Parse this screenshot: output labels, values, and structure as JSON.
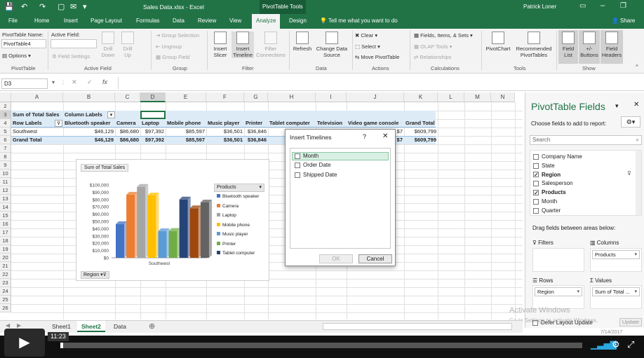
{
  "titlebar": {
    "doc": "Sales Data.xlsx - Excel",
    "tools": "PivotTable Tools",
    "user": "Patrick Loner"
  },
  "tabs": [
    "File",
    "Home",
    "Insert",
    "Page Layout",
    "Formulas",
    "Data",
    "Review",
    "View",
    "Analyze",
    "Design"
  ],
  "tellme": "Tell me what you want to do",
  "share": "Share",
  "ribbon": {
    "pt_name_label": "PivotTable Name:",
    "pt_name": "PivotTable4",
    "options": "Options",
    "group_pivottable": "PivotTable",
    "active_field_label": "Active Field:",
    "field_settings": "Field Settings",
    "drill_down": "Drill Down",
    "drill_up": "Drill Up",
    "group_active_field": "Active Field",
    "group_selection": "Group Selection",
    "ungroup": "Ungroup",
    "group_field": "Group Field",
    "group_group": "Group",
    "insert_slicer": "Insert Slicer",
    "insert_timeline": "Insert Timeline",
    "filter_connections": "Filter Connections",
    "group_filter": "Filter",
    "refresh": "Refresh",
    "change_data_source": "Change Data Source",
    "group_data": "Data",
    "clear": "Clear",
    "select": "Select",
    "move_pivottable": "Move PivotTable",
    "group_actions": "Actions",
    "fields_items_sets": "Fields, Items, & Sets",
    "olap_tools": "OLAP Tools",
    "relationships": "Relationships",
    "group_calculations": "Calculations",
    "pivotchart": "PivotChart",
    "recommended_pivottables": "Recommended PivotTables",
    "group_tools": "Tools",
    "field_list": "Field List",
    "buttons": "+/- Buttons",
    "field_headers": "Field Headers",
    "group_show": "Show"
  },
  "formula": {
    "namebox": "D3",
    "fx": "fx"
  },
  "columns": [
    {
      "l": "A",
      "w": 74
    },
    {
      "l": "B",
      "w": 74
    },
    {
      "l": "C",
      "w": 36
    },
    {
      "l": "D",
      "w": 36
    },
    {
      "l": "E",
      "w": 58
    },
    {
      "l": "F",
      "w": 54
    },
    {
      "l": "G",
      "w": 34
    },
    {
      "l": "H",
      "w": 68
    },
    {
      "l": "I",
      "w": 44
    },
    {
      "l": "J",
      "w": 82
    },
    {
      "l": "K",
      "w": 48
    },
    {
      "l": "L",
      "w": 38
    },
    {
      "l": "M",
      "w": 38
    },
    {
      "l": "N",
      "w": 34
    }
  ],
  "rows": [
    "2",
    "3",
    "4",
    "5",
    "6",
    "7",
    "8",
    "9",
    "10",
    "11",
    "12",
    "13",
    "14",
    "15",
    "16",
    "17",
    "18",
    "19",
    "20",
    "21",
    "22",
    "23",
    "24",
    "25",
    "26"
  ],
  "pivot": {
    "r3a": "Sum of Total Sales",
    "r3b": "Column Labels",
    "headers": [
      "Row Labels",
      "Bluetooth speaker",
      "Camera",
      "Laptop",
      "Mobile phone",
      "Music player",
      "Printer",
      "Tablet computer",
      "Television",
      "Video game console",
      "Grand Total"
    ],
    "r5": [
      "Southwest",
      "$46,129",
      "$86,680",
      "$97,392",
      "$85,597",
      "$36,501",
      "$36,846",
      "",
      "",
      "$7",
      "$609,799"
    ],
    "r6": [
      "Grand Total",
      "$46,129",
      "$86,680",
      "$97,392",
      "$85,597",
      "$36,501",
      "$36,846",
      "",
      "",
      "$7",
      "$609,799"
    ]
  },
  "chart_data": {
    "type": "bar",
    "title": "Sum of Total Sales",
    "categories": [
      "Southwest"
    ],
    "series": [
      {
        "name": "Bluetooth speaker",
        "values": [
          46129
        ],
        "color": "#4472c4"
      },
      {
        "name": "Camera",
        "values": [
          86680
        ],
        "color": "#ed7d31"
      },
      {
        "name": "Laptop",
        "values": [
          97392
        ],
        "color": "#a5a5a5"
      },
      {
        "name": "Mobile phone",
        "values": [
          85597
        ],
        "color": "#ffc000"
      },
      {
        "name": "Music player",
        "values": [
          36501
        ],
        "color": "#5b9bd5"
      },
      {
        "name": "Printer",
        "values": [
          36846
        ],
        "color": "#70ad47"
      },
      {
        "name": "Tablet computer",
        "values": [
          80000
        ],
        "color": "#264478"
      },
      {
        "name": "Television",
        "values": [
          68000
        ],
        "color": "#9e480e"
      },
      {
        "name": "Video game console",
        "values": [
          76000
        ],
        "color": "#636363"
      }
    ],
    "yticks": [
      "$100,000",
      "$90,000",
      "$80,000",
      "$70,000",
      "$60,000",
      "$50,000",
      "$40,000",
      "$30,000",
      "$20,000",
      "$10,000",
      "$0"
    ],
    "ylim": [
      0,
      100000
    ],
    "legend_title": "Products",
    "filter_button": "Region"
  },
  "dialog": {
    "title": "Insert Timelines",
    "help": "?",
    "close": "✕",
    "items": [
      "Month",
      "Order Date",
      "Shipped Date"
    ],
    "ok": "OK",
    "cancel": "Cancel"
  },
  "pane": {
    "title": "PivotTable Fields",
    "subtitle": "Choose fields to add to report:",
    "search": "Search",
    "fields": [
      {
        "n": "Company Name",
        "c": false
      },
      {
        "n": "State",
        "c": false
      },
      {
        "n": "Region",
        "c": true
      },
      {
        "n": "Salesperson",
        "c": false
      },
      {
        "n": "Products",
        "c": true
      },
      {
        "n": "Month",
        "c": false
      },
      {
        "n": "Quarter",
        "c": false
      }
    ],
    "drag": "Drag fields between areas below:",
    "filters": "Filters",
    "columns": "Columns",
    "rows": "Rows",
    "values": "Values",
    "col_item": "Products",
    "row_item": "Region",
    "val_item": "Sum of Total ...",
    "defer": "Defer Layout Update",
    "update": "Update"
  },
  "watermark": {
    "l1": "Activate Windows",
    "l2": "Go to Settings to activate Windows."
  },
  "sheets": [
    "Sheet1",
    "Sheet2",
    "Data"
  ],
  "active_sheet": "Sheet2",
  "video": {
    "time": "11:23",
    "date": "7/14/2017"
  },
  "colors": {
    "excel_green": "#217346",
    "header_blue": "#ddebf7"
  }
}
